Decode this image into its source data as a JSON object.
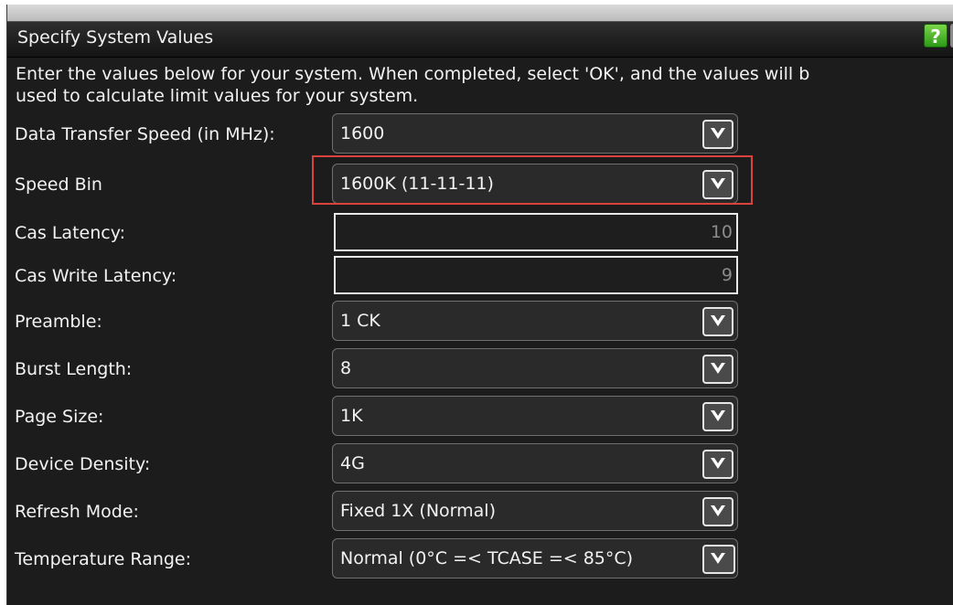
{
  "dialog": {
    "title": "Specify System Values",
    "help_label": "?",
    "instructions": [
      "Enter the values below for your system. When completed, select 'OK', and the values will b",
      "used to calculate limit values for your system."
    ]
  },
  "fields": {
    "data_transfer_speed": {
      "label": "Data Transfer Speed (in MHz):",
      "value": "1600"
    },
    "speed_bin": {
      "label": "Speed Bin",
      "value": "1600K (11-11-11)"
    },
    "cas_latency": {
      "label": "Cas Latency:",
      "value": "10"
    },
    "cas_write_latency": {
      "label": "Cas Write Latency:",
      "value": "9"
    },
    "preamble": {
      "label": "Preamble:",
      "value": "1 CK"
    },
    "burst_length": {
      "label": "Burst Length:",
      "value": "8"
    },
    "page_size": {
      "label": "Page Size:",
      "value": "1K"
    },
    "device_density": {
      "label": "Device Density:",
      "value": "4G"
    },
    "refresh_mode": {
      "label": "Refresh Mode:",
      "value": "Fixed 1X (Normal)"
    },
    "temperature_range": {
      "label": "Temperature Range:",
      "value": "Normal (0°C =< TCASE =< 85°C)"
    }
  },
  "colors": {
    "background": "#1c1c1c",
    "highlight": "#d9433c",
    "help_button": "#3fae22"
  },
  "icons": {
    "dropdown": "chevron-down-icon",
    "help": "help-icon"
  }
}
